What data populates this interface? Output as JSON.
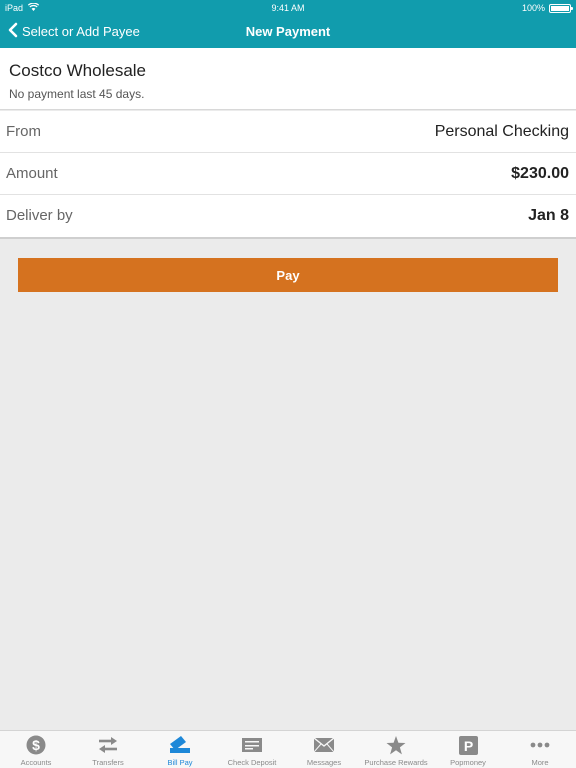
{
  "status_bar": {
    "device": "iPad",
    "time": "9:41 AM",
    "battery": "100%"
  },
  "nav": {
    "back_label": "Select or Add Payee",
    "title": "New Payment"
  },
  "payee": {
    "name": "Costco Wholesale",
    "note": "No payment last 45 days."
  },
  "fields": {
    "from": {
      "label": "From",
      "value": "Personal Checking"
    },
    "amount": {
      "label": "Amount",
      "value": "$230.00"
    },
    "deliver_by": {
      "label": "Deliver by",
      "value": "Jan 8"
    }
  },
  "pay_button_label": "Pay",
  "tabs": [
    {
      "label": "Accounts",
      "icon": "dollar-coin-icon"
    },
    {
      "label": "Transfers",
      "icon": "transfer-arrows-icon"
    },
    {
      "label": "Bill Pay",
      "icon": "bill-pay-icon",
      "active": true
    },
    {
      "label": "Check Deposit",
      "icon": "check-icon"
    },
    {
      "label": "Messages",
      "icon": "envelope-icon"
    },
    {
      "label": "Purchase Rewards",
      "icon": "star-icon"
    },
    {
      "label": "Popmoney",
      "icon": "popmoney-icon"
    },
    {
      "label": "More",
      "icon": "more-dots-icon"
    }
  ],
  "colors": {
    "header": "#119cad",
    "pay_button": "#d5721f",
    "active_tab": "#1e88d8",
    "inactive_tab": "#8a8a8a"
  }
}
